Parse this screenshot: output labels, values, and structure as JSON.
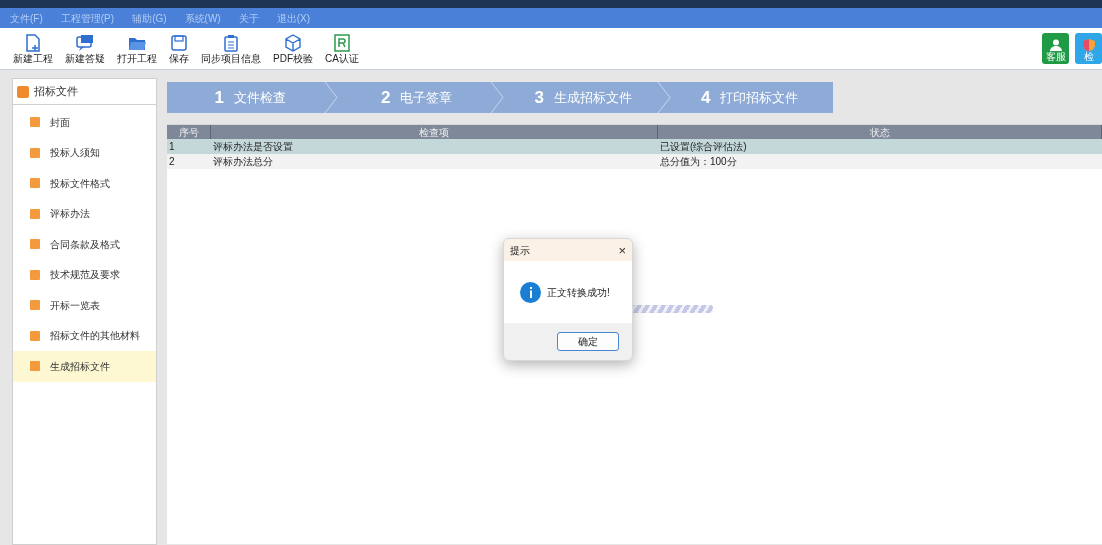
{
  "menu_bar": [
    "文件(F)",
    "工程管理(P)",
    "辅助(G)",
    "系统(W)",
    "关于",
    "退出(X)"
  ],
  "toolbar": [
    {
      "label": "新建工程",
      "kind": "new-file"
    },
    {
      "label": "新建答疑",
      "kind": "chat"
    },
    {
      "label": "打开工程",
      "kind": "folder"
    },
    {
      "label": "保存",
      "kind": "save"
    },
    {
      "label": "同步项目信息",
      "kind": "clipboard"
    },
    {
      "label": "PDF校验",
      "kind": "cube"
    },
    {
      "label": "CA认证",
      "kind": "badge"
    }
  ],
  "toolbar_right": [
    {
      "label": "客服",
      "kind": "user"
    },
    {
      "label": "检",
      "kind": "shield"
    }
  ],
  "sidebar": {
    "title": "招标文件",
    "items": [
      {
        "label": "封面",
        "selected": false
      },
      {
        "label": "投标人须知",
        "selected": false
      },
      {
        "label": "投标文件格式",
        "selected": false
      },
      {
        "label": "评标办法",
        "selected": false
      },
      {
        "label": "合同条款及格式",
        "selected": false
      },
      {
        "label": "技术规范及要求",
        "selected": false
      },
      {
        "label": "开标一览表",
        "selected": false
      },
      {
        "label": "招标文件的其他材料",
        "selected": false
      },
      {
        "label": "生成招标文件",
        "selected": true
      }
    ]
  },
  "steps": [
    {
      "number": "1",
      "label": "文件检查"
    },
    {
      "number": "2",
      "label": "电子签章"
    },
    {
      "number": "3",
      "label": "生成招标文件"
    },
    {
      "number": "4",
      "label": "打印招标文件"
    }
  ],
  "table": {
    "columns": [
      "序号",
      "检查项",
      "状态"
    ],
    "rows": [
      {
        "cells": [
          "1",
          "评标办法是否设置",
          "已设置(综合评估法)"
        ],
        "selected": true
      },
      {
        "cells": [
          "2",
          "评标办法总分",
          "总分值为：100分"
        ],
        "selected": false
      }
    ]
  },
  "progress_bar": {
    "level": 1
  },
  "dialog": {
    "title": "提示",
    "close": "×",
    "message": "正文转换成功!",
    "button": "确定"
  }
}
